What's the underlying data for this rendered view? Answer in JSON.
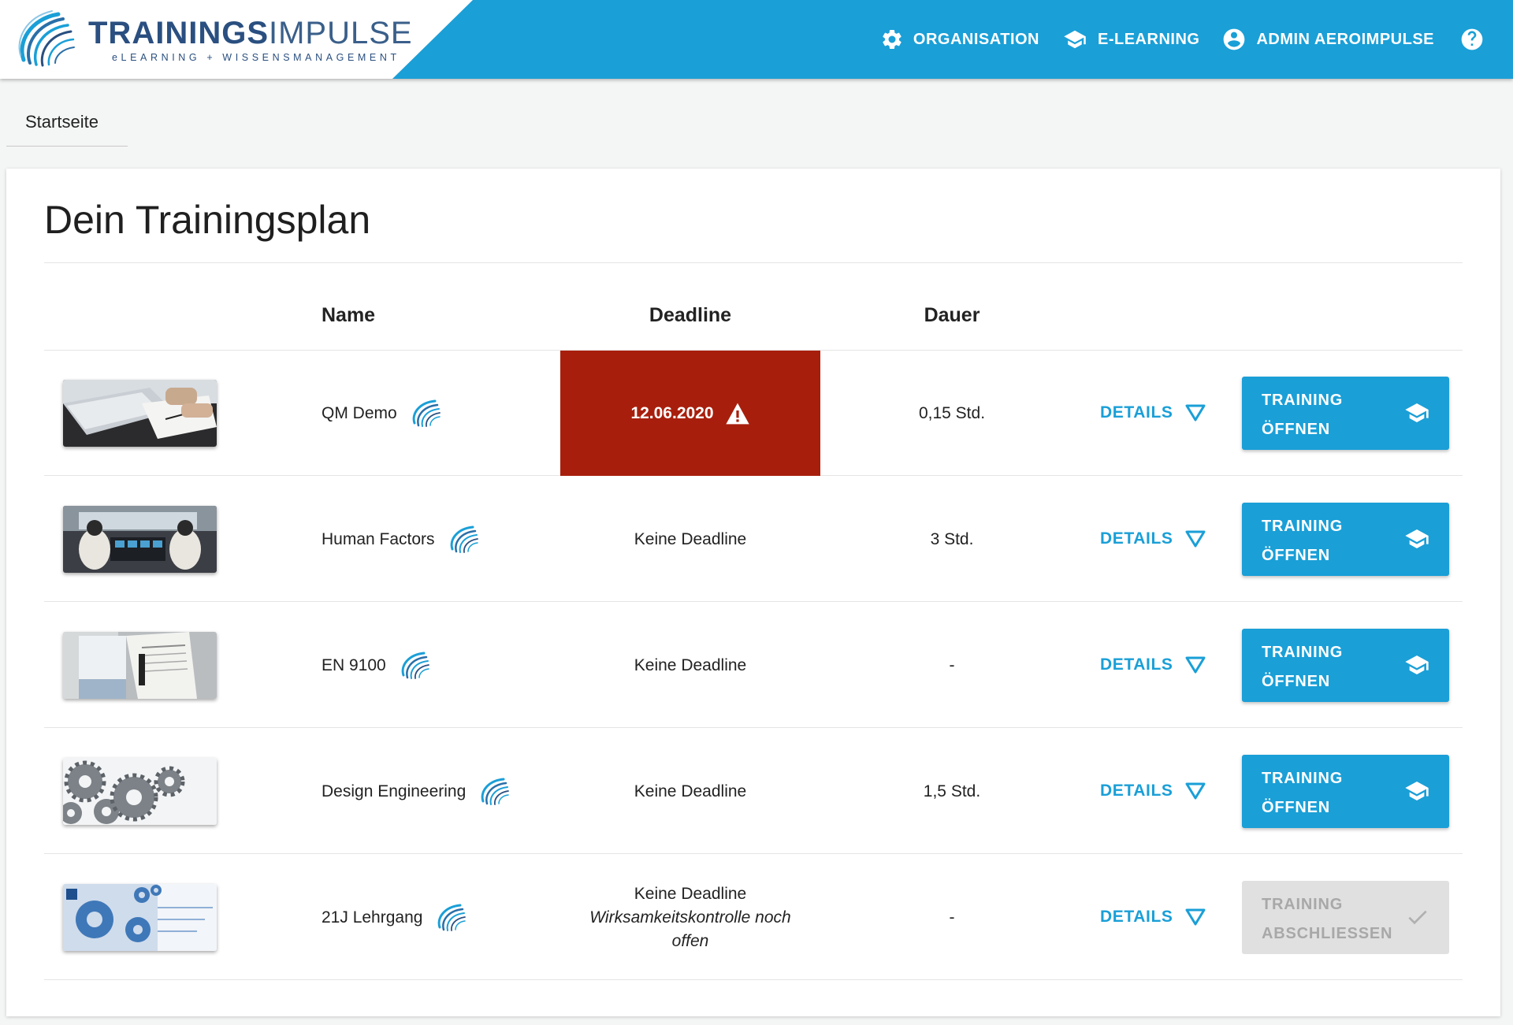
{
  "header": {
    "logo_bold": "TRAININGS",
    "logo_light": "IMPULSE",
    "logo_tagline": "eLEARNING + WISSENSMANAGEMENT",
    "nav": [
      {
        "label": "ORGANISATION",
        "icon": "gear-icon"
      },
      {
        "label": "E-LEARNING",
        "icon": "graduation-cap-icon"
      },
      {
        "label": "ADMIN AEROIMPULSE",
        "icon": "user-circle-icon"
      }
    ],
    "help_icon": "help-icon"
  },
  "breadcrumb": {
    "label": "Startseite"
  },
  "plan": {
    "title": "Dein Trainingsplan",
    "columns": {
      "name": "Name",
      "deadline": "Deadline",
      "dauer": "Dauer"
    },
    "rows": [
      {
        "name": "QM Demo",
        "deadline": "12.06.2020",
        "deadline_note": "",
        "overdue": true,
        "dauer": "0,15 Std.",
        "details_label": "DETAILS",
        "action_line1": "TRAINING",
        "action_line2": "ÖFFNEN",
        "action_enabled": true
      },
      {
        "name": "Human Factors",
        "deadline": "Keine Deadline",
        "deadline_note": "",
        "overdue": false,
        "dauer": "3 Std.",
        "details_label": "DETAILS",
        "action_line1": "TRAINING",
        "action_line2": "ÖFFNEN",
        "action_enabled": true
      },
      {
        "name": "EN 9100",
        "deadline": "Keine Deadline",
        "deadline_note": "",
        "overdue": false,
        "dauer": "-",
        "details_label": "DETAILS",
        "action_line1": "TRAINING",
        "action_line2": "ÖFFNEN",
        "action_enabled": true
      },
      {
        "name": "Design Engineering",
        "deadline": "Keine Deadline",
        "deadline_note": "",
        "overdue": false,
        "dauer": "1,5 Std.",
        "details_label": "DETAILS",
        "action_line1": "TRAINING",
        "action_line2": "ÖFFNEN",
        "action_enabled": true
      },
      {
        "name": "21J Lehrgang",
        "deadline": "Keine Deadline",
        "deadline_note": "Wirksamkeitskontrolle noch offen",
        "overdue": false,
        "dauer": "-",
        "details_label": "DETAILS",
        "action_line1": "TRAINING",
        "action_line2": "ABSCHLIESSEN",
        "action_enabled": false
      }
    ]
  },
  "colors": {
    "primary": "#1a9fd7",
    "overdue": "#a81e0c",
    "logo_text": "#2a4f80",
    "disabled_button": "#e0e0e0",
    "disabled_text": "#a8a8a8"
  }
}
